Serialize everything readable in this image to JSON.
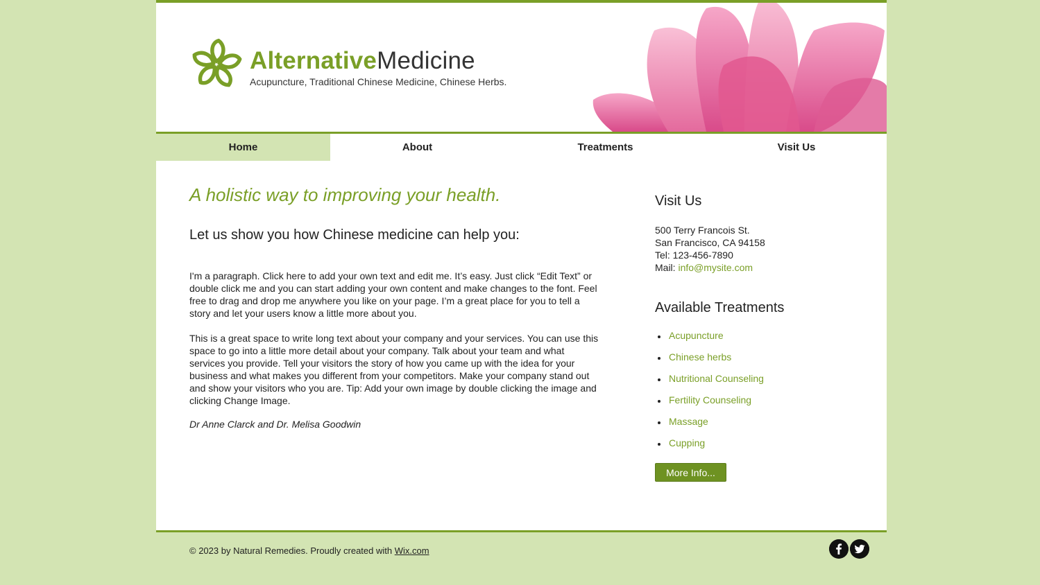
{
  "header": {
    "brand_part1": "Alternative",
    "brand_part2": "Medicine",
    "tagline": "Acupuncture, Traditional Chinese Medicine, Chinese Herbs.",
    "logo_icon": "flower-logo-icon",
    "banner_image": "pink-lotus-flower"
  },
  "nav": {
    "items": [
      {
        "label": "Home",
        "active": true
      },
      {
        "label": "About"
      },
      {
        "label": "Treatments"
      },
      {
        "label": "Visit Us"
      }
    ]
  },
  "main": {
    "headline": "A holistic way to improving your health.",
    "subhead": "Let us show you how Chinese medicine can help you:",
    "paragraph1": "I'm a paragraph. Click here to add your own text and edit me. It’s easy. Just click “Edit Text” or double click me and you can start adding your own content and make changes to the font. Feel free to drag and drop me anywhere you like on your page. I’m a great place for you to tell a story and let your users know a little more about you.",
    "paragraph2": "This is a great space to write long text about your company and your services. You can use this space to go into a little more detail about your company. Talk about your team and what services you provide. Tell your visitors the story of how you came up with the idea for your business and what makes you different from your competitors. Make your company stand out and show your visitors who you are. Tip: Add your own image by double clicking the image and clicking Change Image.",
    "signature": "Dr Anne Clarck and Dr. Melisa Goodwin"
  },
  "sidebar": {
    "visit_title": "Visit Us",
    "address1": "500 Terry Francois St.",
    "address2": "San Francisco, CA 94158",
    "tel": "Tel: 123-456-7890",
    "mail_label": "Mail: ",
    "mail": "info@mysite.com",
    "treatments_title": "Available Treatments",
    "treatments": [
      "Acupuncture",
      "Chinese herbs",
      "Nutritional Counseling",
      "Fertility Counseling",
      "Massage",
      "Cupping"
    ],
    "more_button": "More Info..."
  },
  "footer": {
    "copyright": "© 2023 by Natural Remedies. Proudly created with ",
    "wix_link": "Wix.com",
    "social": [
      "facebook-icon",
      "twitter-icon"
    ]
  },
  "colors": {
    "accent": "#7a9f27",
    "background": "#d3e4b3",
    "button": "#6e9222"
  }
}
